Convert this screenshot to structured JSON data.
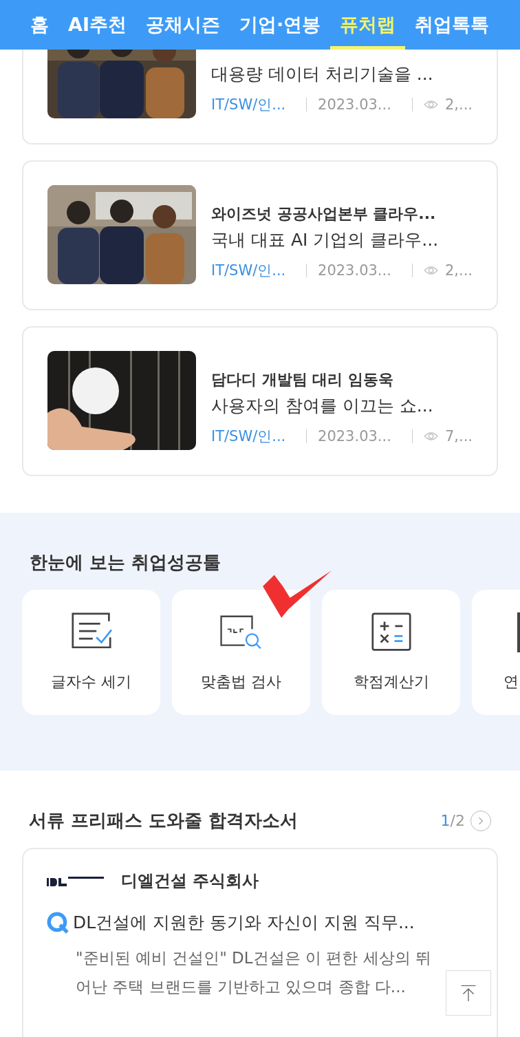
{
  "tabs": [
    {
      "label": "홈",
      "selected": false
    },
    {
      "label": "AI추천",
      "selected": false
    },
    {
      "label": "공채시즌",
      "selected": false
    },
    {
      "label": "기업·연봉",
      "selected": false
    },
    {
      "label": "퓨처랩",
      "selected": true
    },
    {
      "label": "취업톡톡",
      "selected": false
    }
  ],
  "articles": [
    {
      "summary": "대용량 데이터 처리기술을 ...",
      "category": "IT/SW/인...",
      "date": "2023.03...",
      "views": "2,..."
    },
    {
      "title": "와이즈넛 공공사업본부 클라우...",
      "summary": "국내 대표 AI 기업의 클라우...",
      "category": "IT/SW/인...",
      "date": "2023.03...",
      "views": "2,..."
    },
    {
      "title": "담다디 개발팀 대리 임동욱",
      "summary": "사용자의 참여를 이끄는 쇼...",
      "category": "IT/SW/인...",
      "date": "2023.03...",
      "views": "7,..."
    }
  ],
  "tools": {
    "heading": "한눈에 보는 취업성공툴",
    "items": [
      {
        "kind": "count",
        "label": "글자수 세기"
      },
      {
        "kind": "spell",
        "label": "맞춤법 검사"
      },
      {
        "kind": "calc",
        "label": "학점계산기"
      },
      {
        "kind": "partial",
        "label": "연"
      }
    ]
  },
  "essays": {
    "heading": "서류 프리패스 도와줄 합격자소서",
    "page_current": "1",
    "page_total": "/2",
    "card": {
      "company": "디엘건설 주식회사",
      "question": "DL건설에 지원한 동기와 자신이 지원 직무...",
      "answer": "\"준비된 예비 건설인\" DL건설은 이 편한 세상의 뛰어난 주택 브랜드를 기반하고 있으며 종합 다..."
    }
  }
}
